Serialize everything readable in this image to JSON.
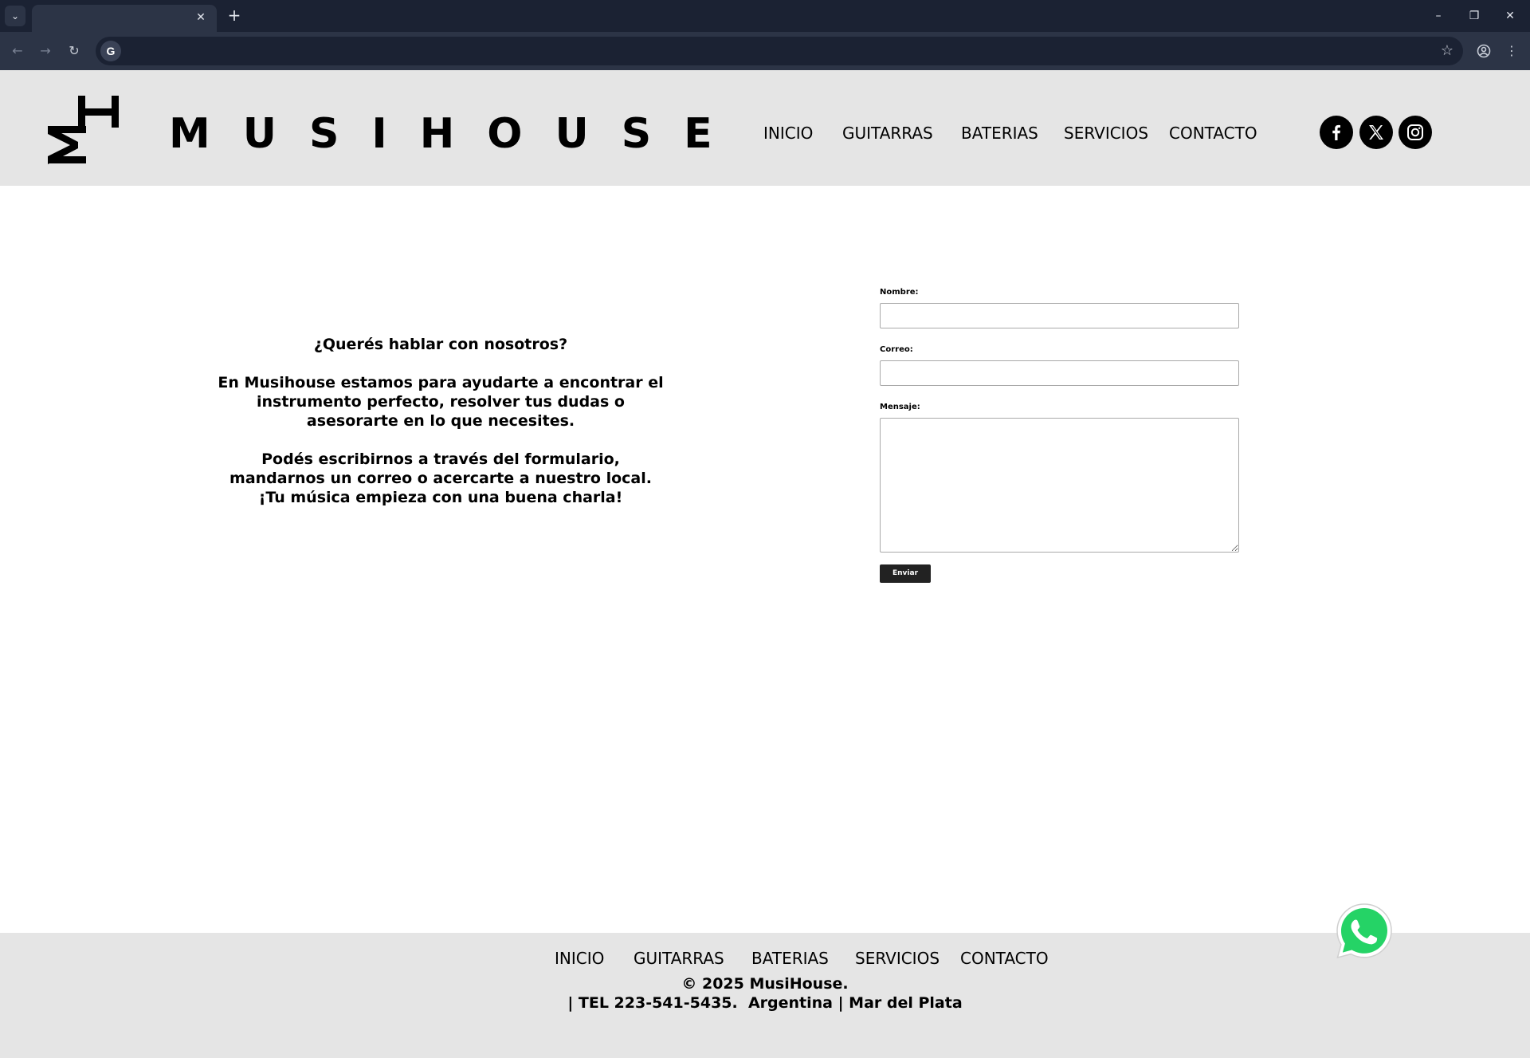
{
  "browser": {
    "tab_title": "",
    "url": "",
    "tab_close_glyph": "✕",
    "new_tab_glyph": "+",
    "tab_menu_glyph": "⌄",
    "omnibox_g": "G",
    "icons": [
      "back-icon",
      "forward-icon",
      "reload-icon",
      "bookmark-star-icon",
      "profile-icon",
      "kebab-menu-icon",
      "minimize-icon",
      "restore-icon",
      "close-icon"
    ]
  },
  "header": {
    "brand": "MUSIHOUSE",
    "logo_letters": "MH",
    "nav": [
      "INICIO",
      "GUITARRAS",
      "BATERIAS",
      "SERVICIOS",
      "CONTACTO"
    ],
    "social_icons": [
      "facebook-icon",
      "x-twitter-icon",
      "instagram-icon"
    ],
    "background": "#e5e5e5"
  },
  "intro": {
    "heading": "¿Querés hablar con nosotros?",
    "paragraph1": "En Musihouse estamos para ayudarte a encontrar el instrumento perfecto, resolver tus dudas o asesorarte en lo que necesites.",
    "paragraph2": "Podés escribirnos a través del formulario, mandarnos un correo o acercarte a nuestro local. ¡Tu música empieza con una buena charla!"
  },
  "form": {
    "name_label": "Nombre:",
    "name_value": "",
    "email_label": "Correo:",
    "email_value": "",
    "message_label": "Mensaje:",
    "message_value": "",
    "submit_label": "Enviar",
    "button_color": "#222222"
  },
  "footer": {
    "nav": [
      "INICIO",
      "GUITARRAS",
      "BATERIAS",
      "SERVICIOS",
      "CONTACTO"
    ],
    "copyright": "© 2025 MusiHouse.",
    "contact": "| TEL 223-541-5435.  Argentina | Mar del Plata",
    "background": "#e5e5e5"
  },
  "floating": {
    "whatsapp_icon": "whatsapp-icon",
    "whatsapp_color": "#25d366"
  }
}
